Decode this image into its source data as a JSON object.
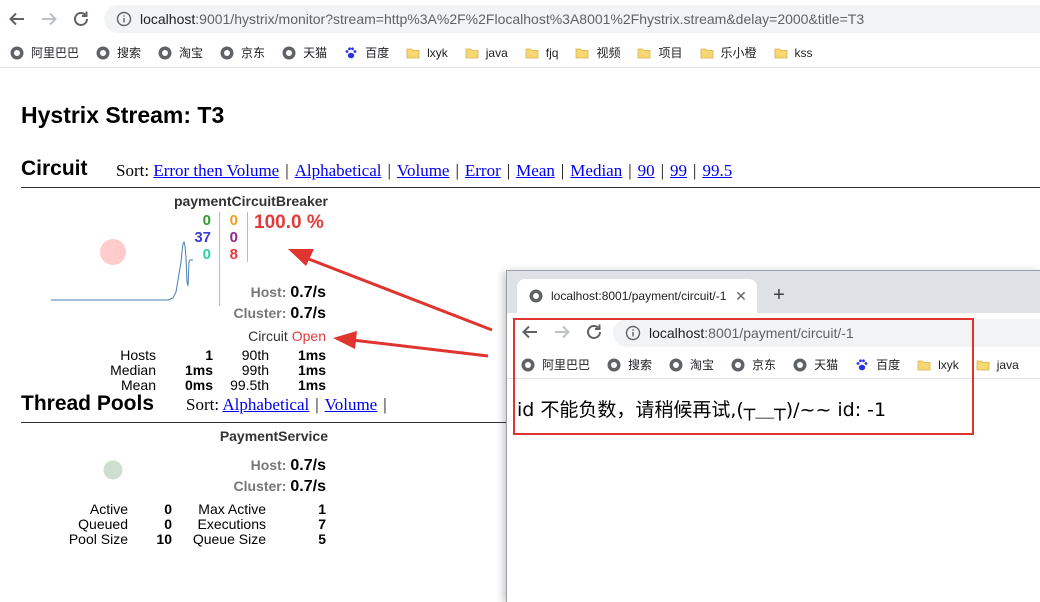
{
  "browser": {
    "url": {
      "host": "localhost",
      "rest": ":9001/hystrix/monitor?stream=http%3A%2F%2Flocalhost%3A8001%2Fhystrix.stream&delay=2000&title=T3"
    },
    "bookmarks": [
      {
        "label": "阿里巴巴",
        "icon": "globe-icon"
      },
      {
        "label": "搜索",
        "icon": "globe-icon"
      },
      {
        "label": "淘宝",
        "icon": "globe-icon"
      },
      {
        "label": "京东",
        "icon": "globe-icon"
      },
      {
        "label": "天猫",
        "icon": "globe-icon"
      },
      {
        "label": "百度",
        "icon": "baidu-paw-icon"
      },
      {
        "label": "lxyk",
        "icon": "folder-icon"
      },
      {
        "label": "java",
        "icon": "folder-icon"
      },
      {
        "label": "fjq",
        "icon": "folder-icon"
      },
      {
        "label": "视频",
        "icon": "folder-icon"
      },
      {
        "label": "项目",
        "icon": "folder-icon"
      },
      {
        "label": "乐小橙",
        "icon": "folder-icon"
      },
      {
        "label": "kss",
        "icon": "folder-icon"
      }
    ]
  },
  "dashboard": {
    "title": "Hystrix Stream: T3",
    "circuit": {
      "heading": "Circuit",
      "sort_label": "Sort:",
      "sort_links": [
        "Error then Volume",
        "Alphabetical",
        "Volume",
        "Error",
        "Mean",
        "Median",
        "90",
        "99",
        "99.5"
      ],
      "name": "paymentCircuitBreaker",
      "counts": {
        "success": "0",
        "short_circuited": "37",
        "bad_request": "0",
        "timeout": "0",
        "rejected": "0",
        "failure": "8"
      },
      "error_percentage": "100.0 %",
      "host_label": "Host:",
      "host_rate": "0.7/s",
      "cluster_label": "Cluster:",
      "cluster_rate": "0.7/s",
      "circuit_label": "Circuit",
      "circuit_state": "Open",
      "metrics": {
        "hosts_label": "Hosts",
        "hosts": "1",
        "median_label": "Median",
        "median": "1ms",
        "mean_label": "Mean",
        "mean": "0ms",
        "p90_label": "90th",
        "p90": "1ms",
        "p99_label": "99th",
        "p99": "1ms",
        "p995_label": "99.5th",
        "p995": "1ms"
      }
    },
    "thread_pools": {
      "heading": "Thread Pools",
      "sort_label": "Sort:",
      "sort_links": [
        "Alphabetical",
        "Volume"
      ],
      "name": "PaymentService",
      "host_label": "Host:",
      "host_rate": "0.7/s",
      "cluster_label": "Cluster:",
      "cluster_rate": "0.7/s",
      "stats": {
        "active_label": "Active",
        "active": "0",
        "queued_label": "Queued",
        "queued": "0",
        "pool_size_label": "Pool Size",
        "pool_size": "10",
        "max_active_label": "Max Active",
        "max_active": "1",
        "executions_label": "Executions",
        "executions": "7",
        "queue_size_label": "Queue Size",
        "queue_size": "5"
      }
    }
  },
  "popup": {
    "tab_title": "localhost:8001/payment/circuit/-1",
    "url": {
      "host": "localhost",
      "rest": ":8001/payment/circuit/-1"
    },
    "bookmarks": [
      {
        "label": "阿里巴巴",
        "icon": "globe-icon"
      },
      {
        "label": "搜索",
        "icon": "globe-icon"
      },
      {
        "label": "淘宝",
        "icon": "globe-icon"
      },
      {
        "label": "京东",
        "icon": "globe-icon"
      },
      {
        "label": "天猫",
        "icon": "globe-icon"
      },
      {
        "label": "百度",
        "icon": "baidu-paw-icon"
      },
      {
        "label": "lxyk",
        "icon": "folder-icon"
      },
      {
        "label": "java",
        "icon": "folder-icon"
      }
    ],
    "body_text": "id 不能负数，请稍候再试,(┬＿┬)/~~ id: -1"
  },
  "colors": {
    "accent_red": "#e33b3b",
    "success_green": "#2e9e2e",
    "short_blue": "#3a3ad6",
    "bad_request_teal": "#2fcfa6",
    "timeout_orange": "#f0a020",
    "rejected_purple": "#8e2a8e",
    "circle_red": "#ffcccc",
    "circle_green": "#cfdfcf",
    "link_blue": "#0000ee"
  }
}
